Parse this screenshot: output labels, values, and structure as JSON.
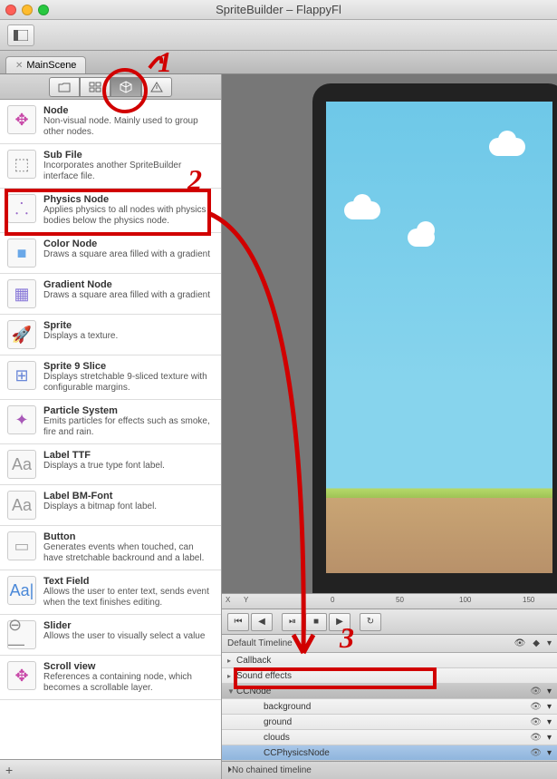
{
  "window": {
    "title": "SpriteBuilder – FlappyFl"
  },
  "tab": {
    "name": "MainScene"
  },
  "library_tabs": [
    "folder",
    "list",
    "cube",
    "warning"
  ],
  "nodes": [
    {
      "title": "Node",
      "desc": "Non-visual node. Mainly used to group other nodes.",
      "icon": "✥",
      "color": "#c848a8"
    },
    {
      "title": "Sub File",
      "desc": "Incorporates another SpriteBuilder interface file.",
      "icon": "⬚",
      "color": "#888"
    },
    {
      "title": "Physics Node",
      "desc": "Applies physics to all nodes with physics bodies below the physics node.",
      "icon": "⸫",
      "color": "#9868c8"
    },
    {
      "title": "Color Node",
      "desc": "Draws a square area filled with a gradient",
      "icon": "■",
      "color": "#6aa8e8"
    },
    {
      "title": "Gradient Node",
      "desc": "Draws a square area filled with a gradient",
      "icon": "▦",
      "color": "#8878d8"
    },
    {
      "title": "Sprite",
      "desc": "Displays a texture.",
      "icon": "🚀",
      "color": "#a8c8e8"
    },
    {
      "title": "Sprite 9 Slice",
      "desc": "Displays stretchable 9-sliced texture with configurable margins.",
      "icon": "⊞",
      "color": "#6a88d8"
    },
    {
      "title": "Particle System",
      "desc": "Emits particles for effects such as smoke, fire and rain.",
      "icon": "✦",
      "color": "#a858b8"
    },
    {
      "title": "Label TTF",
      "desc": "Displays a true type font label.",
      "icon": "Aa",
      "color": "#999"
    },
    {
      "title": "Label BM-Font",
      "desc": "Displays a bitmap font label.",
      "icon": "Aa",
      "color": "#999"
    },
    {
      "title": "Button",
      "desc": "Generates events when touched, can have stretchable backround and a label.",
      "icon": "▭",
      "color": "#aaa"
    },
    {
      "title": "Text Field",
      "desc": "Allows the user to enter text, sends event when the text finishes editing.",
      "icon": "Aa|",
      "color": "#4a88d8"
    },
    {
      "title": "Slider",
      "desc": "Allows the user to visually select a value",
      "icon": "⊖—",
      "color": "#888"
    },
    {
      "title": "Scroll view",
      "desc": "References a containing node, which becomes a scrollable layer.",
      "icon": "✥",
      "color": "#c848a8"
    }
  ],
  "footer_plus": "+",
  "ruler": {
    "xlabel": "X",
    "ylabel": "Y",
    "ticks": [
      "0",
      "50",
      "100",
      "150"
    ]
  },
  "timeline": {
    "title": "Default Timeline",
    "rows": [
      {
        "label": "Callback",
        "indent": 0
      },
      {
        "label": "Sound effects",
        "indent": 0
      }
    ],
    "tree": [
      {
        "label": "CCNode",
        "indent": 0,
        "arrow": "▼"
      },
      {
        "label": "background",
        "indent": 1,
        "arrow": ""
      },
      {
        "label": "ground",
        "indent": 1,
        "arrow": ""
      },
      {
        "label": "clouds",
        "indent": 1,
        "arrow": ""
      },
      {
        "label": "CCPhysicsNode",
        "indent": 1,
        "arrow": "",
        "selected": true
      }
    ],
    "footer": "No chained timeline"
  },
  "annotations": {
    "1": "1",
    "2": "2",
    "3": "3"
  }
}
